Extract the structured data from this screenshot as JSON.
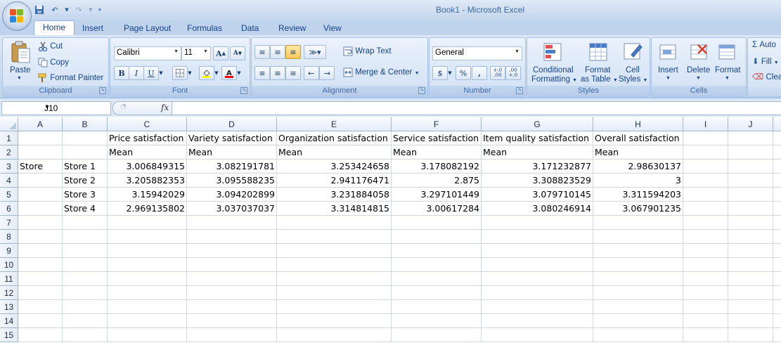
{
  "window": {
    "title": "Book1 - Microsoft Excel"
  },
  "tabs": [
    "Home",
    "Insert",
    "Page Layout",
    "Formulas",
    "Data",
    "Review",
    "View"
  ],
  "ribbon": {
    "clipboard": {
      "label": "Clipboard",
      "paste": "Paste",
      "cut": "Cut",
      "copy": "Copy",
      "format_painter": "Format Painter"
    },
    "font": {
      "label": "Font",
      "font_name": "Calibri",
      "font_size": "11",
      "font_color": "#ff0000",
      "fill_color": "#ffff00"
    },
    "alignment": {
      "label": "Alignment",
      "wrap_text": "Wrap Text",
      "merge_center": "Merge & Center"
    },
    "number": {
      "label": "Number",
      "format": "General",
      "currency": "$",
      "percent": "%",
      "comma": ",",
      "inc_decimal": "+.0 .00",
      "dec_decimal": ".00 +.0"
    },
    "styles": {
      "label": "Styles",
      "conditional_formatting_1": "Conditional",
      "conditional_formatting_2": "Formatting",
      "format_as_table_1": "Format",
      "format_as_table_2": "as Table",
      "cell_styles_1": "Cell",
      "cell_styles_2": "Styles"
    },
    "cells": {
      "label": "Cells",
      "insert": "Insert",
      "delete": "Delete",
      "format": "Format"
    },
    "editing": {
      "autosum": "Auto",
      "fill": "Fill",
      "clear": "Clea"
    }
  },
  "formula_bar": {
    "name_box": "J10",
    "fx": "fx",
    "content": ""
  },
  "columns": [
    "A",
    "B",
    "C",
    "D",
    "E",
    "F",
    "G",
    "H",
    "I",
    "J"
  ],
  "rows": [
    "1",
    "2",
    "3",
    "4",
    "5",
    "6",
    "7",
    "8",
    "9",
    "10",
    "11",
    "12",
    "13",
    "14",
    "15"
  ],
  "sheet": {
    "r1": [
      "",
      "",
      "Price satisfaction",
      "Variety satisfaction",
      "Organization satisfaction",
      "Service satisfaction",
      "Item quality satisfaction",
      "Overall satisfaction",
      "",
      ""
    ],
    "r2": [
      "",
      "",
      "Mean",
      "Mean",
      "Mean",
      "Mean",
      "Mean",
      "Mean",
      "",
      ""
    ],
    "r3": [
      "Store",
      "Store 1",
      "3.006849315",
      "3.082191781",
      "3.253424658",
      "3.178082192",
      "3.171232877",
      "2.98630137",
      "",
      ""
    ],
    "r4": [
      "",
      "Store 2",
      "3.205882353",
      "3.095588235",
      "2.941176471",
      "2.875",
      "3.308823529",
      "3",
      "",
      ""
    ],
    "r5": [
      "",
      "Store 3",
      "3.15942029",
      "3.094202899",
      "3.231884058",
      "3.297101449",
      "3.079710145",
      "3.311594203",
      "",
      ""
    ],
    "r6": [
      "",
      "Store 4",
      "2.969135802",
      "3.037037037",
      "3.314814815",
      "3.00617284",
      "3.080246914",
      "3.067901235",
      "",
      ""
    ]
  }
}
